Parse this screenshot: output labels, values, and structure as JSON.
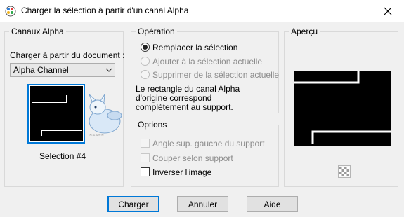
{
  "window": {
    "title": "Charger la sélection à partir d'un canal Alpha",
    "app_icon": "paint-palette-icon",
    "close_icon": "close-icon"
  },
  "alpha_channels": {
    "title": "Canaux Alpha",
    "load_from_label": "Charger à partir du document :",
    "document_select": {
      "value": "Alpha Channel"
    },
    "selection_label": "Selection #4"
  },
  "operation": {
    "title": "Opération",
    "options": [
      {
        "label": "Remplacer la sélection",
        "checked": true,
        "enabled": true
      },
      {
        "label": "Ajouter à la sélection actuelle",
        "checked": false,
        "enabled": false
      },
      {
        "label": "Supprimer de la sélection actuelle",
        "checked": false,
        "enabled": false
      }
    ],
    "note": [
      "Le rectangle du canal Alpha",
      "d'origine correspond",
      "complètement au support."
    ]
  },
  "options": {
    "title": "Options",
    "items": [
      {
        "label": "Angle sup. gauche du support",
        "checked": false,
        "enabled": false
      },
      {
        "label": "Couper selon support",
        "checked": false,
        "enabled": false
      },
      {
        "label": "Inverser l'image",
        "checked": false,
        "enabled": true
      }
    ]
  },
  "preview": {
    "title": "Aperçu",
    "toggle_icon": "checkerboard-icon"
  },
  "buttons": {
    "ok": "Charger",
    "cancel": "Annuler",
    "help": "Aide"
  },
  "colors": {
    "accent": "#0078d7",
    "disabled_text": "#8c8c8c"
  }
}
